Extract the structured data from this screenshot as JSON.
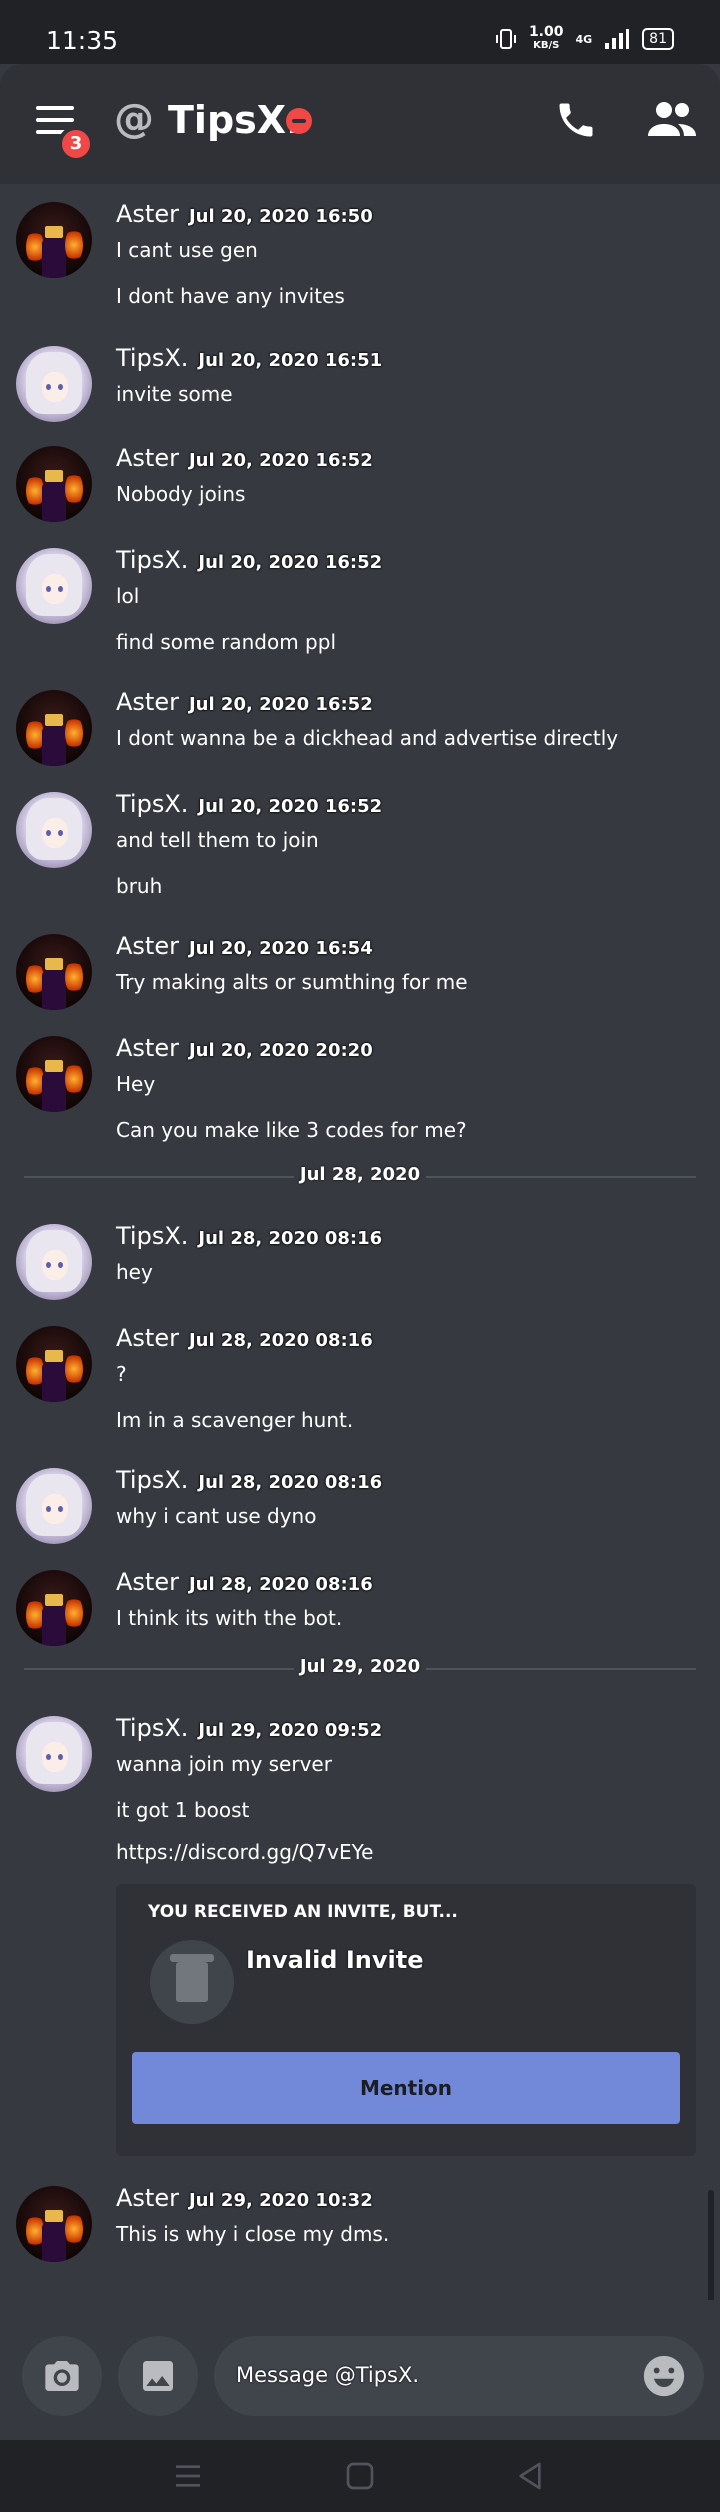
{
  "status": {
    "time": "11:35",
    "speed_value": "1.00",
    "speed_unit": "KB/S",
    "network": "4G",
    "battery": "81"
  },
  "header": {
    "title": "TipsX.",
    "unread_badge": "3"
  },
  "messages": [
    {
      "user": "Aster",
      "avatar": "aster",
      "time": "Jul 20, 2020 16:50",
      "lines": [
        "I cant use gen",
        "I dont have any invites"
      ]
    },
    {
      "user": "TipsX.",
      "avatar": "tips",
      "time": "Jul 20, 2020 16:51",
      "lines": [
        "invite some"
      ]
    },
    {
      "user": "Aster",
      "avatar": "aster",
      "time": "Jul 20, 2020 16:52",
      "lines": [
        "Nobody joins"
      ]
    },
    {
      "user": "TipsX.",
      "avatar": "tips",
      "time": "Jul 20, 2020 16:52",
      "lines": [
        "lol",
        "find some random ppl"
      ]
    },
    {
      "user": "Aster",
      "avatar": "aster",
      "time": "Jul 20, 2020 16:52",
      "lines": [
        "I dont wanna be a dickhead and advertise directly"
      ]
    },
    {
      "user": "TipsX.",
      "avatar": "tips",
      "time": "Jul 20, 2020 16:52",
      "lines": [
        "and tell them to join",
        "bruh"
      ]
    },
    {
      "user": "Aster",
      "avatar": "aster",
      "time": "Jul 20, 2020 16:54",
      "lines": [
        "Try making alts or sumthing for me"
      ]
    },
    {
      "user": "Aster",
      "avatar": "aster",
      "time": "Jul 20, 2020 20:20",
      "lines": [
        "Hey",
        "Can you make like 3 codes for me?"
      ]
    },
    {
      "user": "TipsX.",
      "avatar": "tips",
      "time": "Jul 28, 2020 08:16",
      "lines": [
        "hey"
      ]
    },
    {
      "user": "Aster",
      "avatar": "aster",
      "time": "Jul 28, 2020 08:16",
      "lines": [
        "?",
        "Im in a scavenger hunt."
      ]
    },
    {
      "user": "TipsX.",
      "avatar": "tips",
      "time": "Jul 28, 2020 08:16",
      "lines": [
        "why i cant use dyno"
      ]
    },
    {
      "user": "Aster",
      "avatar": "aster",
      "time": "Jul 28, 2020 08:16",
      "lines": [
        "I think its with the bot."
      ]
    },
    {
      "user": "TipsX.",
      "avatar": "tips",
      "time": "Jul 29, 2020 09:52",
      "lines": [
        "wanna join my server",
        "it got 1 boost",
        "https://discord.gg/Q7vEYe"
      ]
    },
    {
      "user": "Aster",
      "avatar": "aster",
      "time": "Jul 29, 2020 10:32",
      "lines": [
        "This is why i close my dms."
      ]
    }
  ],
  "dividers": [
    "Jul 28, 2020",
    "Jul 29, 2020"
  ],
  "invite": {
    "heading": "YOU RECEIVED AN INVITE, BUT...",
    "title": "Invalid Invite",
    "button": "Mention"
  },
  "composer": {
    "placeholder": "Message @TipsX."
  }
}
